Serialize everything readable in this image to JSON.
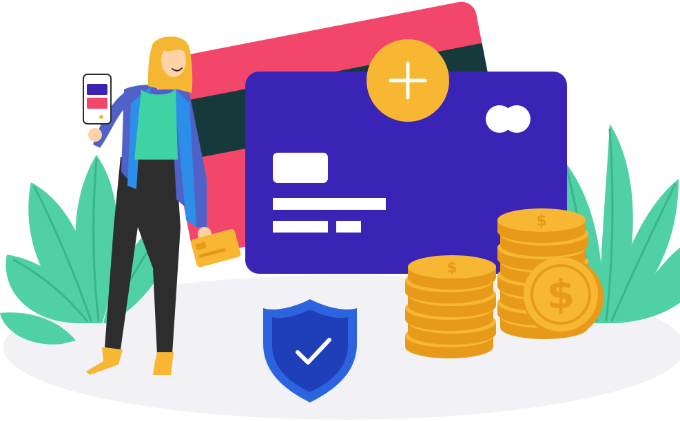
{
  "illustration": {
    "subject": "woman-with-credit-cards-and-coins",
    "icons": [
      "plus-icon",
      "checkmark-icon",
      "dollar-icon",
      "shield-icon"
    ],
    "colors": {
      "card_front": "#3A24B5",
      "card_back_red": "#F2476B",
      "card_back_dark": "#16393C",
      "coin_gold": "#F7B733",
      "coin_edge": "#E79A1A",
      "leaf": "#4FD1A5",
      "leaf_vein": "#3BB48D",
      "shield_outer": "#2C64E0",
      "shield_inner": "#1F3FB8",
      "plus_badge": "#F7B733",
      "ground": "#F1F1F6",
      "shirt": "#3FD2A3",
      "jacket": "#5061C7",
      "pants": "#2D2D2D",
      "hair": "#F5B731",
      "skin": "#FFD2A8"
    }
  }
}
